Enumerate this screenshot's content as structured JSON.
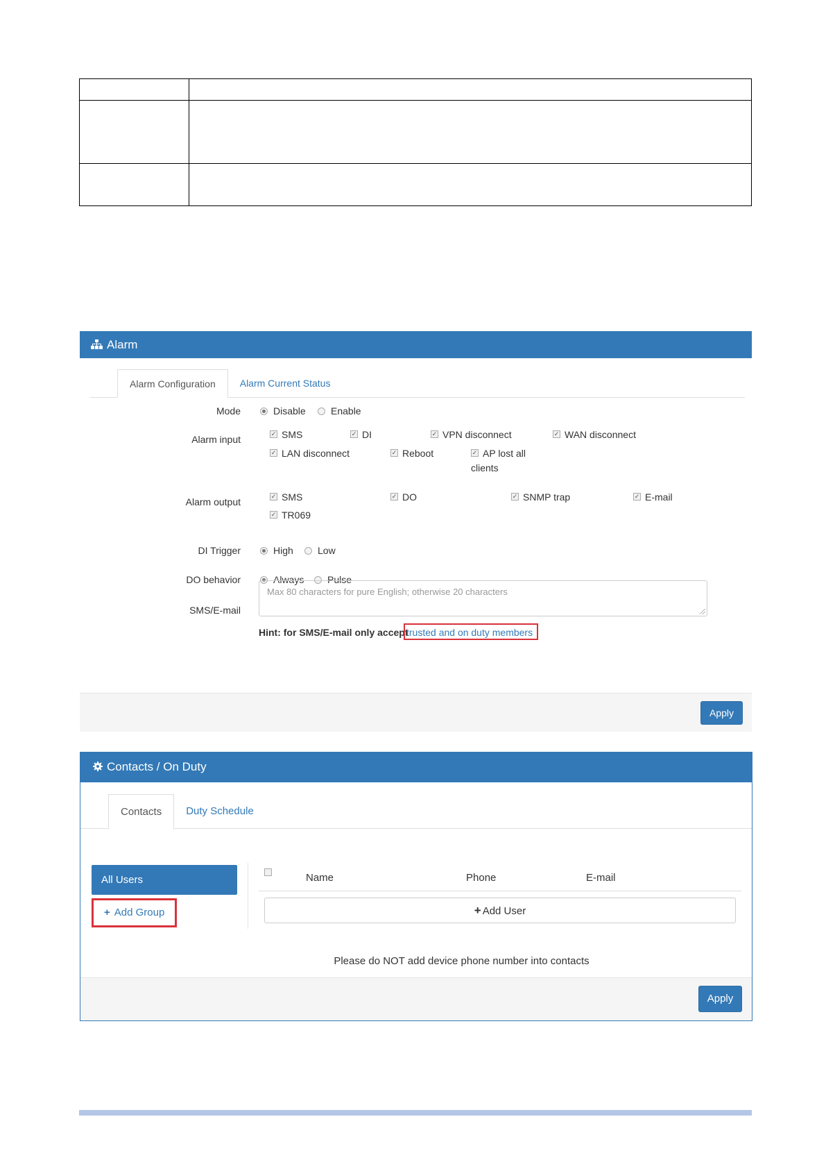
{
  "alarm": {
    "title": "Alarm",
    "tabs": [
      "Alarm Configuration",
      "Alarm Current Status"
    ],
    "mode": {
      "label": "Mode",
      "options": [
        "Disable",
        "Enable"
      ],
      "selected": "Disable"
    },
    "alarm_input": {
      "label": "Alarm input",
      "options": [
        "SMS",
        "DI",
        "VPN disconnect",
        "WAN disconnect",
        "LAN disconnect",
        "Reboot",
        "AP lost all",
        "clients"
      ]
    },
    "alarm_output": {
      "label": "Alarm output",
      "options": [
        "SMS",
        "DO",
        "SNMP trap",
        "E-mail",
        "TR069"
      ]
    },
    "di_trigger": {
      "label": "DI Trigger",
      "options": [
        "High",
        "Low"
      ],
      "selected": "High"
    },
    "do_behavior": {
      "label": "DO behavior",
      "options": [
        "Always",
        "Pulse"
      ],
      "selected": "Always"
    },
    "sms_email": {
      "label": "SMS/E-mail",
      "placeholder": "Max 80 characters for pure English; otherwise 20 characters"
    },
    "hint_prefix": "Hint: for SMS/E-mail only accept",
    "hint_link": "trusted and on duty members",
    "apply_label": "Apply"
  },
  "contacts": {
    "title": "Contacts / On Duty",
    "tabs": [
      "Contacts",
      "Duty Schedule"
    ],
    "all_users": "All Users",
    "add_group": "Add Group",
    "columns": [
      "Name",
      "Phone",
      "E-mail"
    ],
    "add_user": "Add User",
    "warning": "Please do NOT add device phone number into contacts",
    "apply_label": "Apply"
  },
  "colors": {
    "primary": "#3379b7",
    "highlight": "#d9323a",
    "rule": "#b4c6e7"
  }
}
